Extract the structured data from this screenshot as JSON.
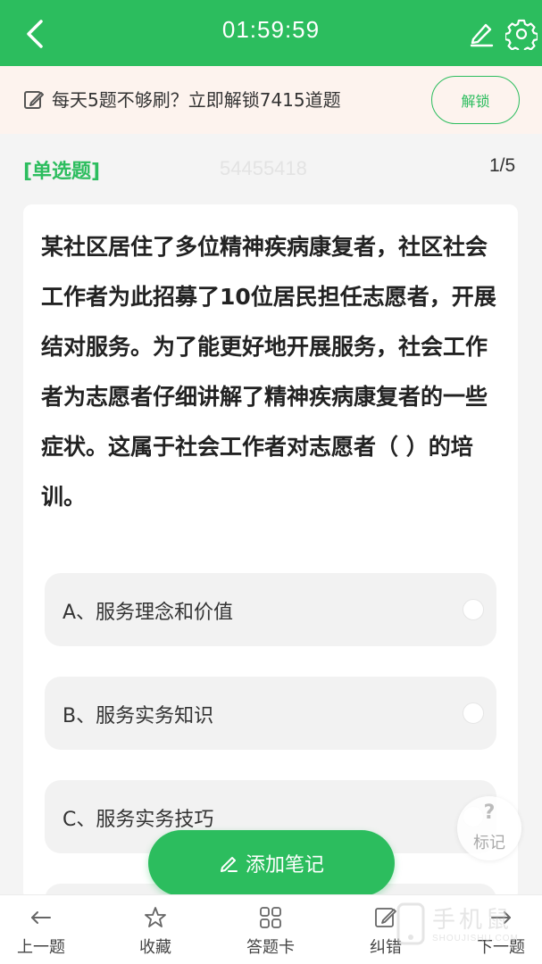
{
  "header": {
    "timer": "01:59:59"
  },
  "promo": {
    "text": "每天5题不够刷？立即解锁7415道题",
    "unlock_label": "解锁"
  },
  "question": {
    "type_label": "[单选题]",
    "watermark_number": "54455418",
    "progress": "1/5",
    "text": "某社区居住了多位精神疾病康复者，社区社会工作者为此招募了10位居民担任志愿者，开展结对服务。为了能更好地开展服务，社会工作者为志愿者仔细讲解了精神疾病康复者的一些症状。这属于社会工作者对志愿者（ ）的培训。",
    "options": [
      {
        "label": "A、服务理念和价值"
      },
      {
        "label": "B、服务实务知识"
      },
      {
        "label": "C、服务实务技巧"
      }
    ]
  },
  "mark_button": {
    "symbol": "?",
    "label": "标记"
  },
  "note_button": {
    "label": "添加笔记"
  },
  "tabbar": {
    "items": [
      {
        "label": "上一题",
        "icon": "arrow-left-icon"
      },
      {
        "label": "收藏",
        "icon": "star-icon"
      },
      {
        "label": "答题卡",
        "icon": "grid-icon"
      },
      {
        "label": "纠错",
        "icon": "edit-icon"
      },
      {
        "label": "下一题",
        "icon": "arrow-right-icon"
      }
    ]
  },
  "brand_watermark": {
    "cn": "手机鼠",
    "en": "SHOUJISHU.COM"
  },
  "colors": {
    "accent": "#2cbd5e",
    "promo_bg": "#fdf3ee",
    "page_bg": "#f4f4f4"
  }
}
